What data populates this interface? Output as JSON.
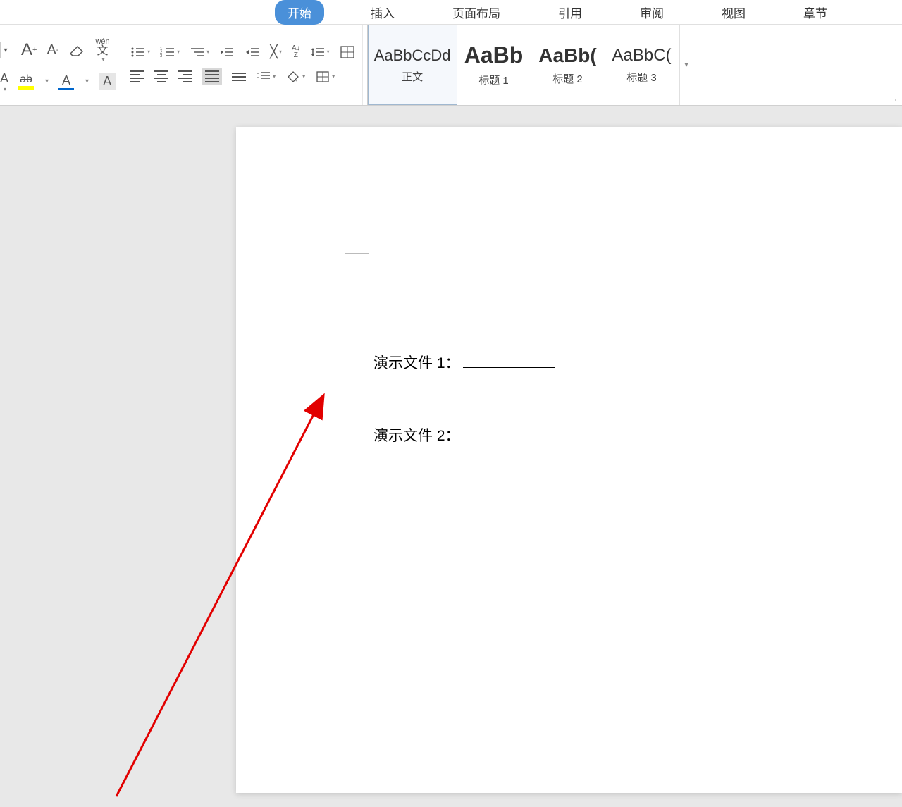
{
  "tabs": {
    "start": "开始",
    "insert": "插入",
    "layout": "页面布局",
    "reference": "引用",
    "review": "审阅",
    "view": "视图",
    "chapter": "章节"
  },
  "ribbon": {
    "font_increase": "A",
    "font_decrease": "A",
    "phonetic": "wén",
    "phonetic_sub": "文",
    "strikethrough": "ab",
    "font_color_letter": "A",
    "char_shading": "A",
    "sort": "AZ",
    "highlight_letter": "A"
  },
  "styles": [
    {
      "preview": "AaBbCcDd",
      "label": "正文",
      "selected": true,
      "class": ""
    },
    {
      "preview": "AaBb",
      "label": "标题 1",
      "selected": false,
      "class": "bold"
    },
    {
      "preview": "AaBb(",
      "label": "标题 2",
      "selected": false,
      "class": "bold2"
    },
    {
      "preview": "AaBbC(",
      "label": "标题 3",
      "selected": false,
      "class": ""
    }
  ],
  "document": {
    "line1": "演示文件 1：",
    "line2": "演示文件 2："
  }
}
